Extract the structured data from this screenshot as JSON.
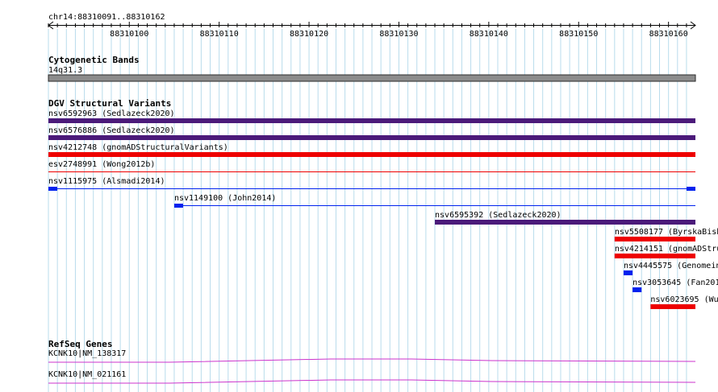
{
  "ruler": {
    "position": "chr14:88310091..88310162",
    "start": 88310091,
    "end": 88310162,
    "ticks": [
      "88310100",
      "88310110",
      "88310120",
      "88310130",
      "88310140",
      "88310150",
      "88310160"
    ]
  },
  "cytobands": {
    "title": "Cytogenetic Bands",
    "band": "14q31.3"
  },
  "dgv": {
    "title": "DGV Structural Variants",
    "features": [
      {
        "label": "nsv6592963 (Sedlazeck2020)",
        "start": 88310091,
        "end": 88310163,
        "type": "bar",
        "color": "#4b1a7a"
      },
      {
        "label": "nsv6576886 (Sedlazeck2020)",
        "start": 88310091,
        "end": 88310163,
        "type": "bar",
        "color": "#4b1a7a"
      },
      {
        "label": "nsv4212748 (gnomADStructuralVariants)",
        "start": 88310091,
        "end": 88310163,
        "type": "bar",
        "color": "#ee0000"
      },
      {
        "label": "esv2748991 (Wong2012b)",
        "start": 88310091,
        "end": 88310163,
        "type": "line",
        "color": "#ee0000"
      },
      {
        "label": "nsv1115975 (Alsmadi2014)",
        "start": 88310091,
        "end": 88310163,
        "type": "line-ends",
        "color": "#0022ee"
      },
      {
        "label": "nsv1149100 (John2014)",
        "start": 88310105,
        "end": 88310163,
        "type": "line-start",
        "color": "#0022ee"
      },
      {
        "label": "nsv6595392 (Sedlazeck2020)",
        "start": 88310134,
        "end": 88310163,
        "type": "bar",
        "color": "#4b1a7a"
      },
      {
        "label": "nsv5508177 (ByrskaBish",
        "start": 88310154,
        "end": 88310163,
        "type": "bar",
        "color": "#ee0000"
      },
      {
        "label": "nsv4214151 (gnomADStru",
        "start": 88310154,
        "end": 88310163,
        "type": "bar",
        "color": "#ee0000"
      },
      {
        "label": "nsv4445575 (Genomein",
        "start": 88310155,
        "end": 88310156,
        "type": "bar",
        "color": "#0022ee"
      },
      {
        "label": "nsv3053645 (Fan201",
        "start": 88310156,
        "end": 88310157,
        "type": "bar",
        "color": "#0022ee"
      },
      {
        "label": "nsv6023695 (Wu2",
        "start": 88310158,
        "end": 88310163,
        "type": "bar",
        "color": "#ee0000"
      }
    ]
  },
  "refseq": {
    "title": "RefSeq Genes",
    "genes": [
      {
        "label": "KCNK10|NM_138317"
      },
      {
        "label": "KCNK10|NM_021161"
      }
    ]
  }
}
